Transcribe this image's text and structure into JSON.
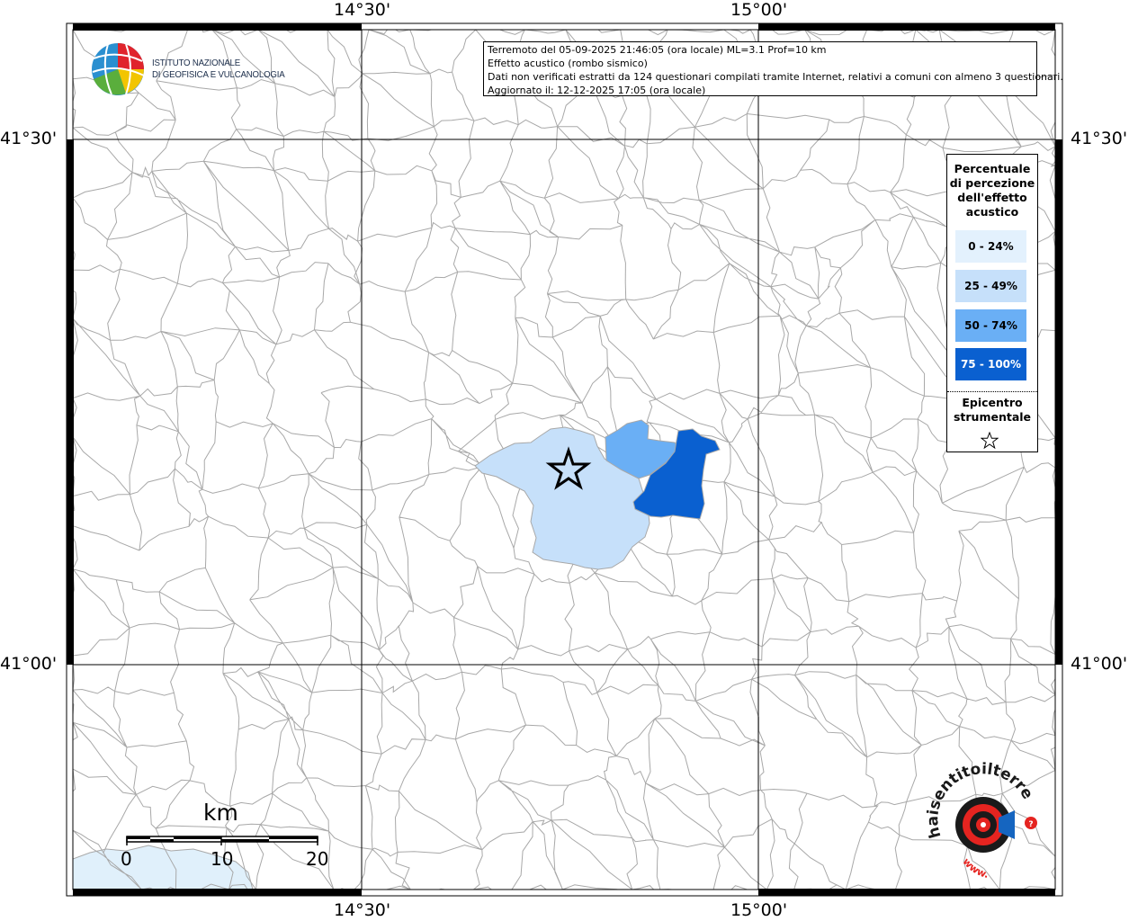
{
  "header": {
    "line1": "Terremoto del 05-09-2025 21:46:05 (ora locale) ML=3.1 Prof=10 km",
    "line2": "Effetto acustico (rombo sismico)",
    "line3": "Dati non verificati estratti da 124 questionari compilati tramite Internet, relativi a comuni con almeno 3 questionari.",
    "line4": "Aggiornato il: 12-12-2025 17:05 (ora locale)"
  },
  "logo_ingv": {
    "line1": "ISTITUTO NAZIONALE",
    "line2": "DI GEOFISICA E VULCANOLOGIA"
  },
  "coordinates": {
    "lon_left": "14°30'",
    "lon_right": "15°00'",
    "lat_top": "41°30'",
    "lat_bottom": "41°00'"
  },
  "legend": {
    "title": [
      "Percentuale",
      "di percezione",
      "dell'effetto",
      "acustico"
    ],
    "items": [
      {
        "label": "0 - 24%",
        "color": "#e3f1fd",
        "text_color": "#000000"
      },
      {
        "label": "25 - 49%",
        "color": "#c6e0fa",
        "text_color": "#000000"
      },
      {
        "label": "50 - 74%",
        "color": "#6aaff5",
        "text_color": "#000000"
      },
      {
        "label": "75 - 100%",
        "color": "#0a60d0",
        "text_color": "#ffffff"
      }
    ],
    "epicenter": [
      "Epicentro",
      "strumentale"
    ]
  },
  "scale": {
    "unit": "km",
    "labels": [
      "0",
      "10",
      "20"
    ]
  },
  "colors": {
    "sea": "#e0f0fb",
    "boundaries": "#a8a8a8",
    "frame": "#000000"
  },
  "badge": {
    "text": "haisentitoilterremoto.it",
    "prefix": "www."
  }
}
